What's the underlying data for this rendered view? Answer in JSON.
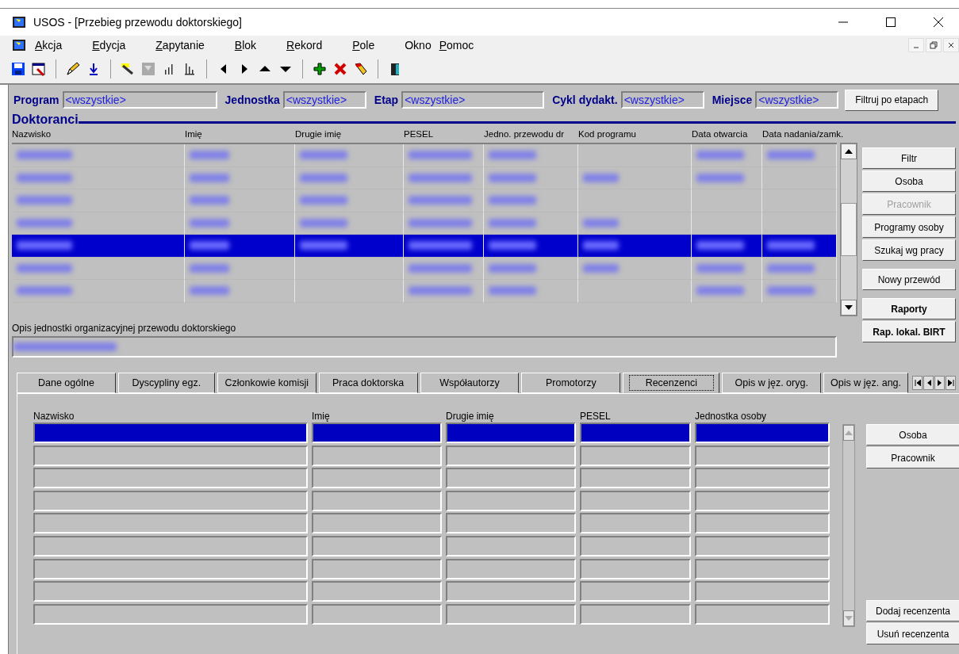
{
  "window": {
    "title": "USOS - [Przebieg przewodu doktorskiego]"
  },
  "menu": [
    {
      "label": "Akcja",
      "mnemonic": true
    },
    {
      "label": "Edycja",
      "mnemonic": true
    },
    {
      "label": "Zapytanie",
      "mnemonic": true
    },
    {
      "label": "Blok",
      "mnemonic": true
    },
    {
      "label": "Rekord",
      "mnemonic": true
    },
    {
      "label": "Pole",
      "mnemonic": true
    },
    {
      "label": "Okno",
      "mnemonic": false
    },
    {
      "label": "Pomoc",
      "mnemonic": true
    }
  ],
  "filters": [
    {
      "label": "Program",
      "value": "<wszystkie>"
    },
    {
      "label": "Jednostka",
      "value": "<wszystkie>"
    },
    {
      "label": "Etap",
      "value": "<wszystkie>"
    },
    {
      "label": "Cykl dydakt.",
      "value": "<wszystkie>"
    },
    {
      "label": "Miejsce",
      "value": "<wszystkie>"
    }
  ],
  "filter_button": "Filtruj po etapach",
  "doktoranci": {
    "title": "Doktoranci",
    "columns": [
      "Nazwisko",
      "Imię",
      "Drugie imię",
      "PESEL",
      "Jedno. przewodu dr",
      "Kod programu",
      "Data otwarcia",
      "Data nadania/zamk."
    ],
    "rows": [
      {
        "selected": false,
        "cells": [
          true,
          true,
          true,
          true,
          true,
          false,
          true,
          true
        ]
      },
      {
        "selected": false,
        "cells": [
          true,
          true,
          true,
          true,
          true,
          true,
          true,
          false
        ]
      },
      {
        "selected": false,
        "cells": [
          true,
          true,
          true,
          true,
          true,
          false,
          false,
          false
        ]
      },
      {
        "selected": false,
        "cells": [
          true,
          true,
          true,
          true,
          true,
          true,
          false,
          false
        ]
      },
      {
        "selected": true,
        "cells": [
          true,
          true,
          true,
          true,
          true,
          true,
          true,
          true
        ]
      },
      {
        "selected": false,
        "cells": [
          true,
          true,
          false,
          true,
          true,
          true,
          true,
          true
        ]
      },
      {
        "selected": false,
        "cells": [
          true,
          true,
          false,
          true,
          true,
          false,
          true,
          true
        ]
      }
    ],
    "description_label": "Opis jednostki organizacyjnej przewodu doktorskiego",
    "description_filled": true,
    "button_groups": [
      [
        {
          "label": "Filtr",
          "disabled": false,
          "bold": false
        },
        {
          "label": "Osoba",
          "disabled": false,
          "bold": false
        },
        {
          "label": "Pracownik",
          "disabled": true,
          "bold": false
        },
        {
          "label": "Programy osoby",
          "disabled": false,
          "bold": false
        },
        {
          "label": "Szukaj wg pracy",
          "disabled": false,
          "bold": false
        }
      ],
      [
        {
          "label": "Nowy przewód",
          "disabled": false,
          "bold": false
        }
      ],
      [
        {
          "label": "Raporty",
          "disabled": false,
          "bold": true
        },
        {
          "label": "Rap. lokal. BIRT",
          "disabled": false,
          "bold": true
        }
      ]
    ]
  },
  "tabs": [
    {
      "label": "Dane ogólne",
      "selected": false
    },
    {
      "label": "Dyscypliny egz.",
      "selected": false
    },
    {
      "label": "Członkowie komisji",
      "selected": false
    },
    {
      "label": "Praca doktorska",
      "selected": false
    },
    {
      "label": "Współautorzy",
      "selected": false
    },
    {
      "label": "Promotorzy",
      "selected": false
    },
    {
      "label": "Recenzenci",
      "selected": true
    },
    {
      "label": "Opis w jęz. oryg.",
      "selected": false
    },
    {
      "label": "Opis w jęz. ang.",
      "selected": false
    }
  ],
  "recenzenci": {
    "columns": [
      "Nazwisko",
      "Imię",
      "Drugie imię",
      "PESEL",
      "Jednostka osoby"
    ],
    "rows": [
      {
        "selected": true
      },
      {
        "selected": false
      },
      {
        "selected": false
      },
      {
        "selected": false
      },
      {
        "selected": false
      },
      {
        "selected": false
      },
      {
        "selected": false
      },
      {
        "selected": false
      },
      {
        "selected": false
      }
    ],
    "top_buttons": [
      "Osoba",
      "Pracownik"
    ],
    "bottom_buttons": [
      "Dodaj recenzenta",
      "Usuń recenzenta"
    ]
  }
}
